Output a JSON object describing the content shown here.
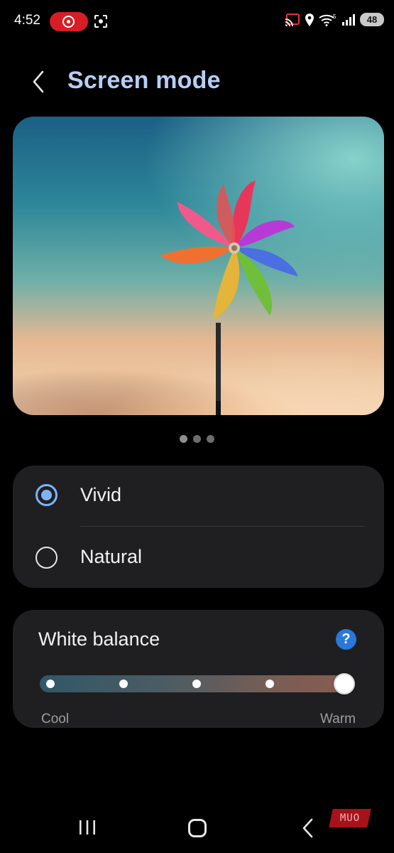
{
  "status_bar": {
    "time": "4:52",
    "battery": "48",
    "network_label": "5"
  },
  "header": {
    "title": "Screen mode"
  },
  "preview": {
    "image": "pinwheel-photo",
    "page_count": 3,
    "active_page": 1
  },
  "screen_mode": {
    "options": [
      {
        "label": "Vivid",
        "selected": true
      },
      {
        "label": "Natural",
        "selected": false
      }
    ]
  },
  "white_balance": {
    "title": "White balance",
    "help_symbol": "?",
    "min_label": "Cool",
    "max_label": "Warm",
    "steps": 5,
    "selected_step": 5
  },
  "watermark": {
    "text": "MUO"
  },
  "colors": {
    "accent": "#7fb3f3",
    "title": "#b7cef6",
    "help": "#2a78da",
    "record": "#d81d24",
    "card": "#1f1f22"
  }
}
